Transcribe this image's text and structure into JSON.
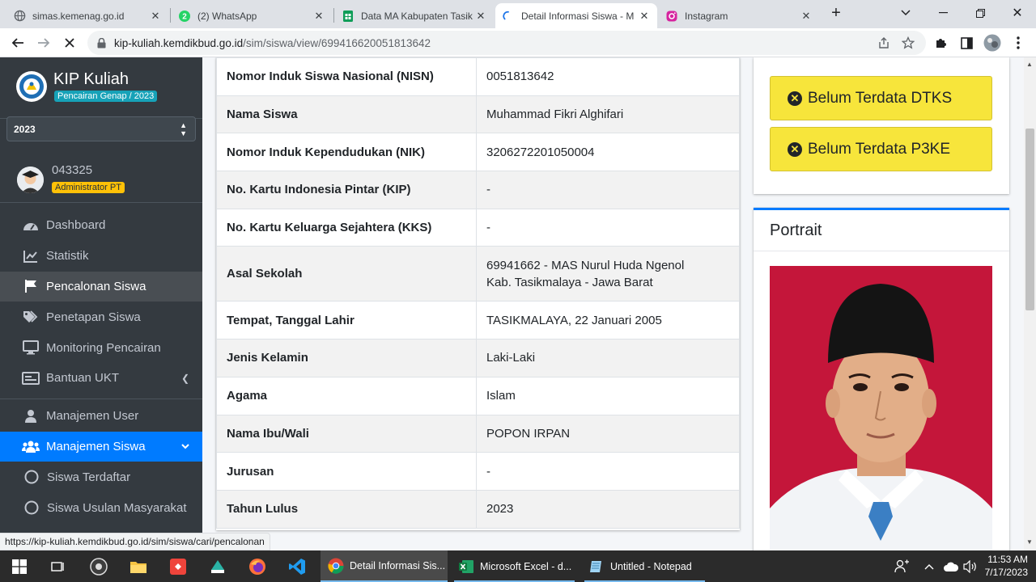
{
  "browser": {
    "tabs": [
      {
        "title": "simas.kemenag.go.id",
        "icon": "globe-icon",
        "active": false
      },
      {
        "title": "(2) WhatsApp",
        "icon": "whatsapp-icon",
        "active": false
      },
      {
        "title": "Data MA Kabupaten Tasik",
        "icon": "sheets-icon",
        "active": false
      },
      {
        "title": "Detail Informasi Siswa - M",
        "icon": "loading-icon",
        "active": true
      },
      {
        "title": "Instagram",
        "icon": "instagram-icon",
        "active": false
      }
    ],
    "url_host": "kip-kuliah.kemdikbud.go.id",
    "url_path": "/sim/siswa/view/699416620051813642",
    "status_url": "https://kip-kuliah.kemdikbud.go.id/sim/siswa/cari/pencalonan"
  },
  "sidebar": {
    "brand_title": "KIP Kuliah",
    "brand_badge": "Pencairan Genap / 2023",
    "year": "2023",
    "user_id": "043325",
    "user_role": "Administrator PT",
    "items": [
      {
        "label": "Dashboard",
        "icon": "dashboard-icon"
      },
      {
        "label": "Statistik",
        "icon": "chart-line-icon"
      },
      {
        "label": "Pencalonan Siswa",
        "icon": "flag-icon"
      },
      {
        "label": "Penetapan Siswa",
        "icon": "tags-icon"
      },
      {
        "label": "Monitoring Pencairan",
        "icon": "monitor-icon"
      },
      {
        "label": "Bantuan UKT",
        "icon": "id-card-icon"
      },
      {
        "label": "Manajemen User",
        "icon": "user-icon"
      },
      {
        "label": "Manajemen Siswa",
        "icon": "users-icon"
      },
      {
        "label": "Siswa Terdaftar",
        "icon": "circle-icon"
      },
      {
        "label": "Siswa Usulan Masyarakat",
        "icon": "circle-icon"
      }
    ]
  },
  "detail": {
    "rows": [
      {
        "label": "Nomor Induk Siswa Nasional (NISN)",
        "value": "0051813642"
      },
      {
        "label": "Nama Siswa",
        "value": "Muhammad Fikri Alghifari"
      },
      {
        "label": "Nomor Induk Kependudukan (NIK)",
        "value": "3206272201050004"
      },
      {
        "label": "No. Kartu Indonesia Pintar (KIP)",
        "value": "-"
      },
      {
        "label": "No. Kartu Keluarga Sejahtera (KKS)",
        "value": "-"
      },
      {
        "label": "Asal Sekolah",
        "value": "69941662 - MAS Nurul Huda Ngenol",
        "value2": "Kab. Tasikmalaya - Jawa Barat"
      },
      {
        "label": "Tempat, Tanggal Lahir",
        "value": "TASIKMALAYA, 22 Januari 2005"
      },
      {
        "label": "Jenis Kelamin",
        "value": "Laki-Laki"
      },
      {
        "label": "Agama",
        "value": "Islam"
      },
      {
        "label": "Nama Ibu/Wali",
        "value": "POPON IRPAN"
      },
      {
        "label": "Jurusan",
        "value": "-"
      },
      {
        "label": "Tahun Lulus",
        "value": "2023"
      }
    ]
  },
  "status_buttons": {
    "dtks": "Belum Terdata DTKS",
    "p3ke": "Belum Terdata P3KE"
  },
  "portrait": {
    "title": "Portrait"
  },
  "taskbar": {
    "apps": [
      {
        "label": "Detail Informasi Sis...",
        "icon": "chrome-icon"
      },
      {
        "label": "Microsoft Excel - d...",
        "icon": "excel-icon"
      },
      {
        "label": "Untitled - Notepad",
        "icon": "notepad-icon"
      }
    ],
    "time": "11:53 AM",
    "date": "7/17/2023"
  },
  "colors": {
    "accent": "#007bff",
    "sidebar": "#343a40",
    "warning": "#f7e53b",
    "portrait_bg": "#c4163a"
  }
}
